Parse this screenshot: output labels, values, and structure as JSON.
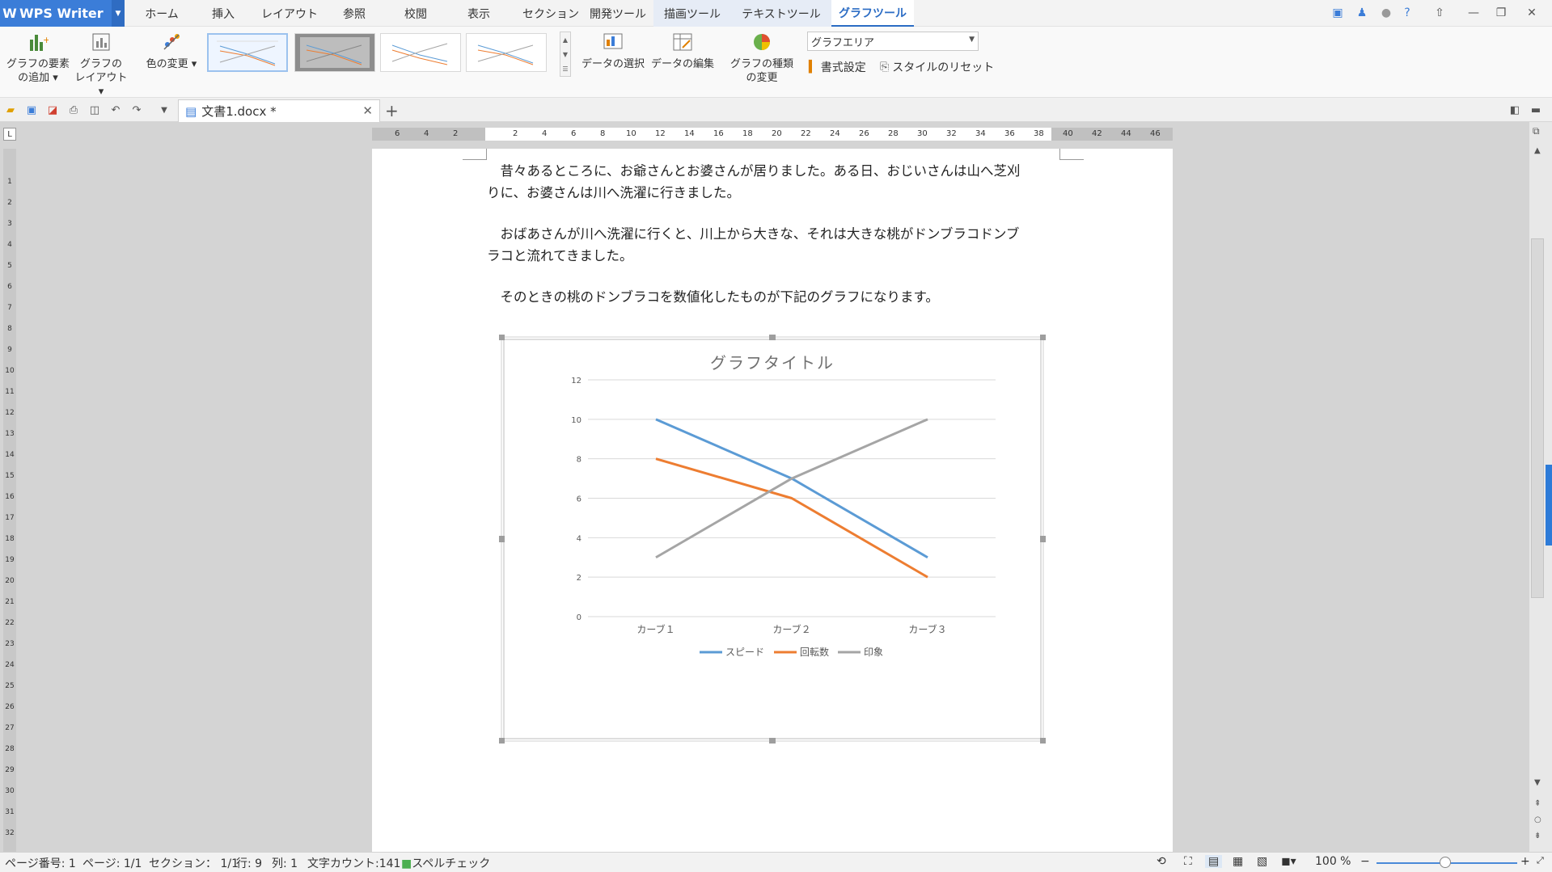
{
  "app": {
    "name": "WPS Writer"
  },
  "menu": {
    "tabs": [
      "ホーム",
      "挿入",
      "レイアウト",
      "参照",
      "校閲",
      "表示",
      "セクション",
      "開発ツール"
    ],
    "context_tabs": [
      "描画ツール",
      "テキストツール",
      "グラフツール"
    ],
    "active_tab": "グラフツール"
  },
  "ribbon": {
    "add_element": {
      "line1": "グラフの要素",
      "line2": "の追加"
    },
    "chart_layout": {
      "line1": "グラフの",
      "line2": "レイアウト"
    },
    "change_color": "色の変更",
    "select_data": "データの選択",
    "edit_data": "データの編集",
    "change_type": {
      "line1": "グラフの種類",
      "line2": "の変更"
    },
    "area_select": "グラフエリア",
    "format_settings": "書式設定",
    "reset_style": "スタイルのリセット"
  },
  "document_tab": {
    "title": "文書1.docx *"
  },
  "document": {
    "paragraphs": [
      {
        "line1": "昔々あるところに、お爺さんとお婆さんが居りました。ある日、おじいさんは山へ芝刈",
        "line2": "りに、お婆さんは川へ洗濯に行きました。"
      },
      {
        "line1": "おばあさんが川へ洗濯に行くと、川上から大きな、それは大きな桃がドンブラコドンブ",
        "line2": "ラコと流れてきました。"
      },
      {
        "line1": "そのときの桃のドンブラコを数値化したものが下記のグラフになります。",
        "line2": ""
      }
    ]
  },
  "ruler": {
    "h": [
      "6",
      "4",
      "2",
      "2",
      "4",
      "6",
      "8",
      "10",
      "12",
      "14",
      "16",
      "18",
      "20",
      "22",
      "24",
      "26",
      "28",
      "30",
      "32",
      "34",
      "36",
      "38",
      "40",
      "42",
      "44",
      "46"
    ],
    "v": [
      "1",
      "2",
      "3",
      "4",
      "5",
      "6",
      "7",
      "8",
      "9",
      "10",
      "11",
      "12",
      "13",
      "14",
      "15",
      "16",
      "17",
      "18",
      "19",
      "20",
      "21",
      "22",
      "23",
      "24",
      "25",
      "26",
      "27",
      "28",
      "29",
      "30",
      "31",
      "32"
    ]
  },
  "chart_data": {
    "type": "line",
    "title": "グラフタイトル",
    "categories": [
      "カーブ１",
      "カーブ２",
      "カーブ３"
    ],
    "series": [
      {
        "name": "スピード",
        "values": [
          10,
          7,
          3
        ],
        "color": "#5b9bd5"
      },
      {
        "name": "回転数",
        "values": [
          8,
          6,
          2
        ],
        "color": "#ed7d31"
      },
      {
        "name": "印象",
        "values": [
          3,
          7,
          10
        ],
        "color": "#a5a5a5"
      }
    ],
    "ylim": [
      0,
      12
    ],
    "yticks": [
      "0",
      "2",
      "4",
      "6",
      "8",
      "10",
      "12"
    ],
    "grid": true,
    "legend": "bottom"
  },
  "status": {
    "page_no": "ページ番号: 1",
    "pages": "ページ: 1/1",
    "section": "セクション： 1/1",
    "row": "行: 9",
    "col": "列: 1",
    "word_count": "文字カウント:141",
    "spell_check": "スペルチェック",
    "zoom": "100 %"
  }
}
